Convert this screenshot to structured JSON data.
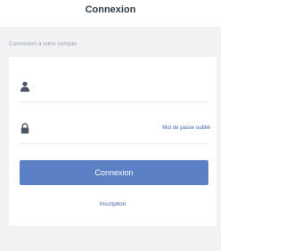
{
  "header": {
    "title": "Connexion"
  },
  "form": {
    "section_label": "Connexion à votre compte",
    "username_icon": "user-icon",
    "password_icon": "lock-icon",
    "forgot_password": "Mot de passe oublié",
    "submit_label": "Connexion",
    "signup_link": "Inscription"
  },
  "colors": {
    "accent": "#5b80c4",
    "link": "#3f64a8",
    "background": "#f1f2f4"
  }
}
